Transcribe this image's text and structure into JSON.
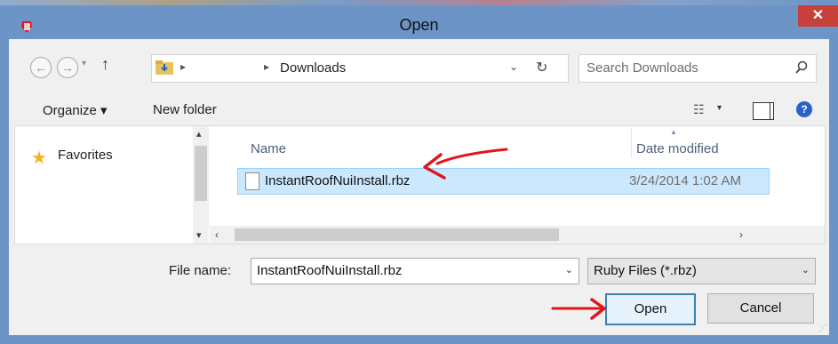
{
  "window": {
    "title": "Open",
    "close_glyph": "✕"
  },
  "nav": {
    "back_glyph": "←",
    "forward_glyph": "→",
    "dropdown_glyph": "▾",
    "up_glyph": "↑"
  },
  "address": {
    "separator": "▸",
    "path": "Downloads",
    "dropdown_glyph": "⌄",
    "refresh_glyph": "↻"
  },
  "search": {
    "placeholder": "Search Downloads"
  },
  "toolbar": {
    "organize_label": "Organize ▾",
    "new_folder_label": "New folder",
    "view_glyph": "☷",
    "view_dropdown_glyph": "▾",
    "help_glyph": "?"
  },
  "navpane": {
    "favorites_label": "Favorites",
    "star_glyph": "★"
  },
  "scroll": {
    "up": "▴",
    "down": "▾",
    "left": "‹",
    "right": "›"
  },
  "files": {
    "columns": {
      "name": "Name",
      "date_modified": "Date modified"
    },
    "rows": [
      {
        "name": "InstantRoofNuiInstall.rbz",
        "date": "3/24/2014 1:02 AM"
      }
    ]
  },
  "bottom": {
    "filename_label": "File name:",
    "filename_value": "InstantRoofNuiInstall.rbz",
    "filetype_value": "Ruby Files (*.rbz)",
    "dropdown_glyph": "⌄",
    "open_label": "Open",
    "cancel_label": "Cancel",
    "grip_glyph": "⋰"
  },
  "colors": {
    "titlebar": "#6d94c6",
    "close": "#c7403a",
    "selection": "#cce8ff",
    "annotation_red": "#e0161b"
  }
}
